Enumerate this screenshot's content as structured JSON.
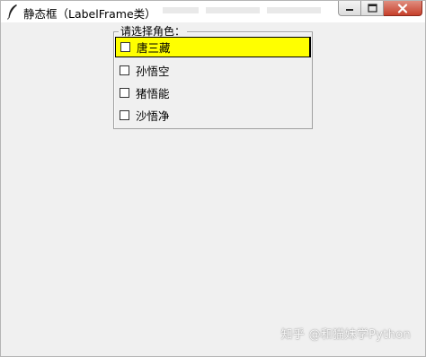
{
  "window": {
    "title": "静态框（LabelFrame类）",
    "app_icon": "feather-icon",
    "caption_icons": [
      "minimize-icon",
      "maximize-icon",
      "close-icon"
    ]
  },
  "labelframe": {
    "label": "请选择角色：",
    "options": [
      {
        "label": "唐三藏",
        "checked": false,
        "selected": true
      },
      {
        "label": "孙悟空",
        "checked": false,
        "selected": false
      },
      {
        "label": "猪悟能",
        "checked": false,
        "selected": false
      },
      {
        "label": "沙悟净",
        "checked": false,
        "selected": false
      }
    ]
  },
  "watermark": "知乎 @和猫妹学Python",
  "colors": {
    "window_bg": "#f0f0f0",
    "selected_bg": "#ffff00",
    "close_button": "#c7402b"
  }
}
